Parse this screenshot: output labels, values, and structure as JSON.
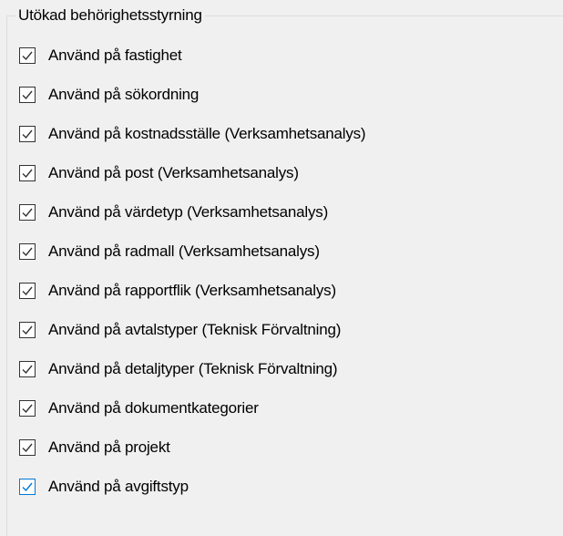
{
  "group": {
    "title": "Utökad behörighetsstyrning"
  },
  "colors": {
    "checkmark": "#333333",
    "checkmark_focused": "#0078d7",
    "background": "#f0f0f0"
  },
  "options": [
    {
      "label": "Använd på fastighet",
      "checked": true
    },
    {
      "label": "Använd på sökordning",
      "checked": true
    },
    {
      "label": "Använd på kostnadsställe (Verksamhetsanalys)",
      "checked": true
    },
    {
      "label": "Använd på post (Verksamhetsanalys)",
      "checked": true
    },
    {
      "label": "Använd på värdetyp (Verksamhetsanalys)",
      "checked": true
    },
    {
      "label": "Använd på radmall (Verksamhetsanalys)",
      "checked": true
    },
    {
      "label": "Använd på rapportflik (Verksamhetsanalys)",
      "checked": true
    },
    {
      "label": "Använd på avtalstyper (Teknisk Förvaltning)",
      "checked": true
    },
    {
      "label": "Använd på detaljtyper (Teknisk Förvaltning)",
      "checked": true
    },
    {
      "label": "Använd på dokumentkategorier",
      "checked": true
    },
    {
      "label": "Använd på projekt",
      "checked": true
    },
    {
      "label": "Använd på avgiftstyp",
      "checked": true,
      "focused": true
    }
  ]
}
